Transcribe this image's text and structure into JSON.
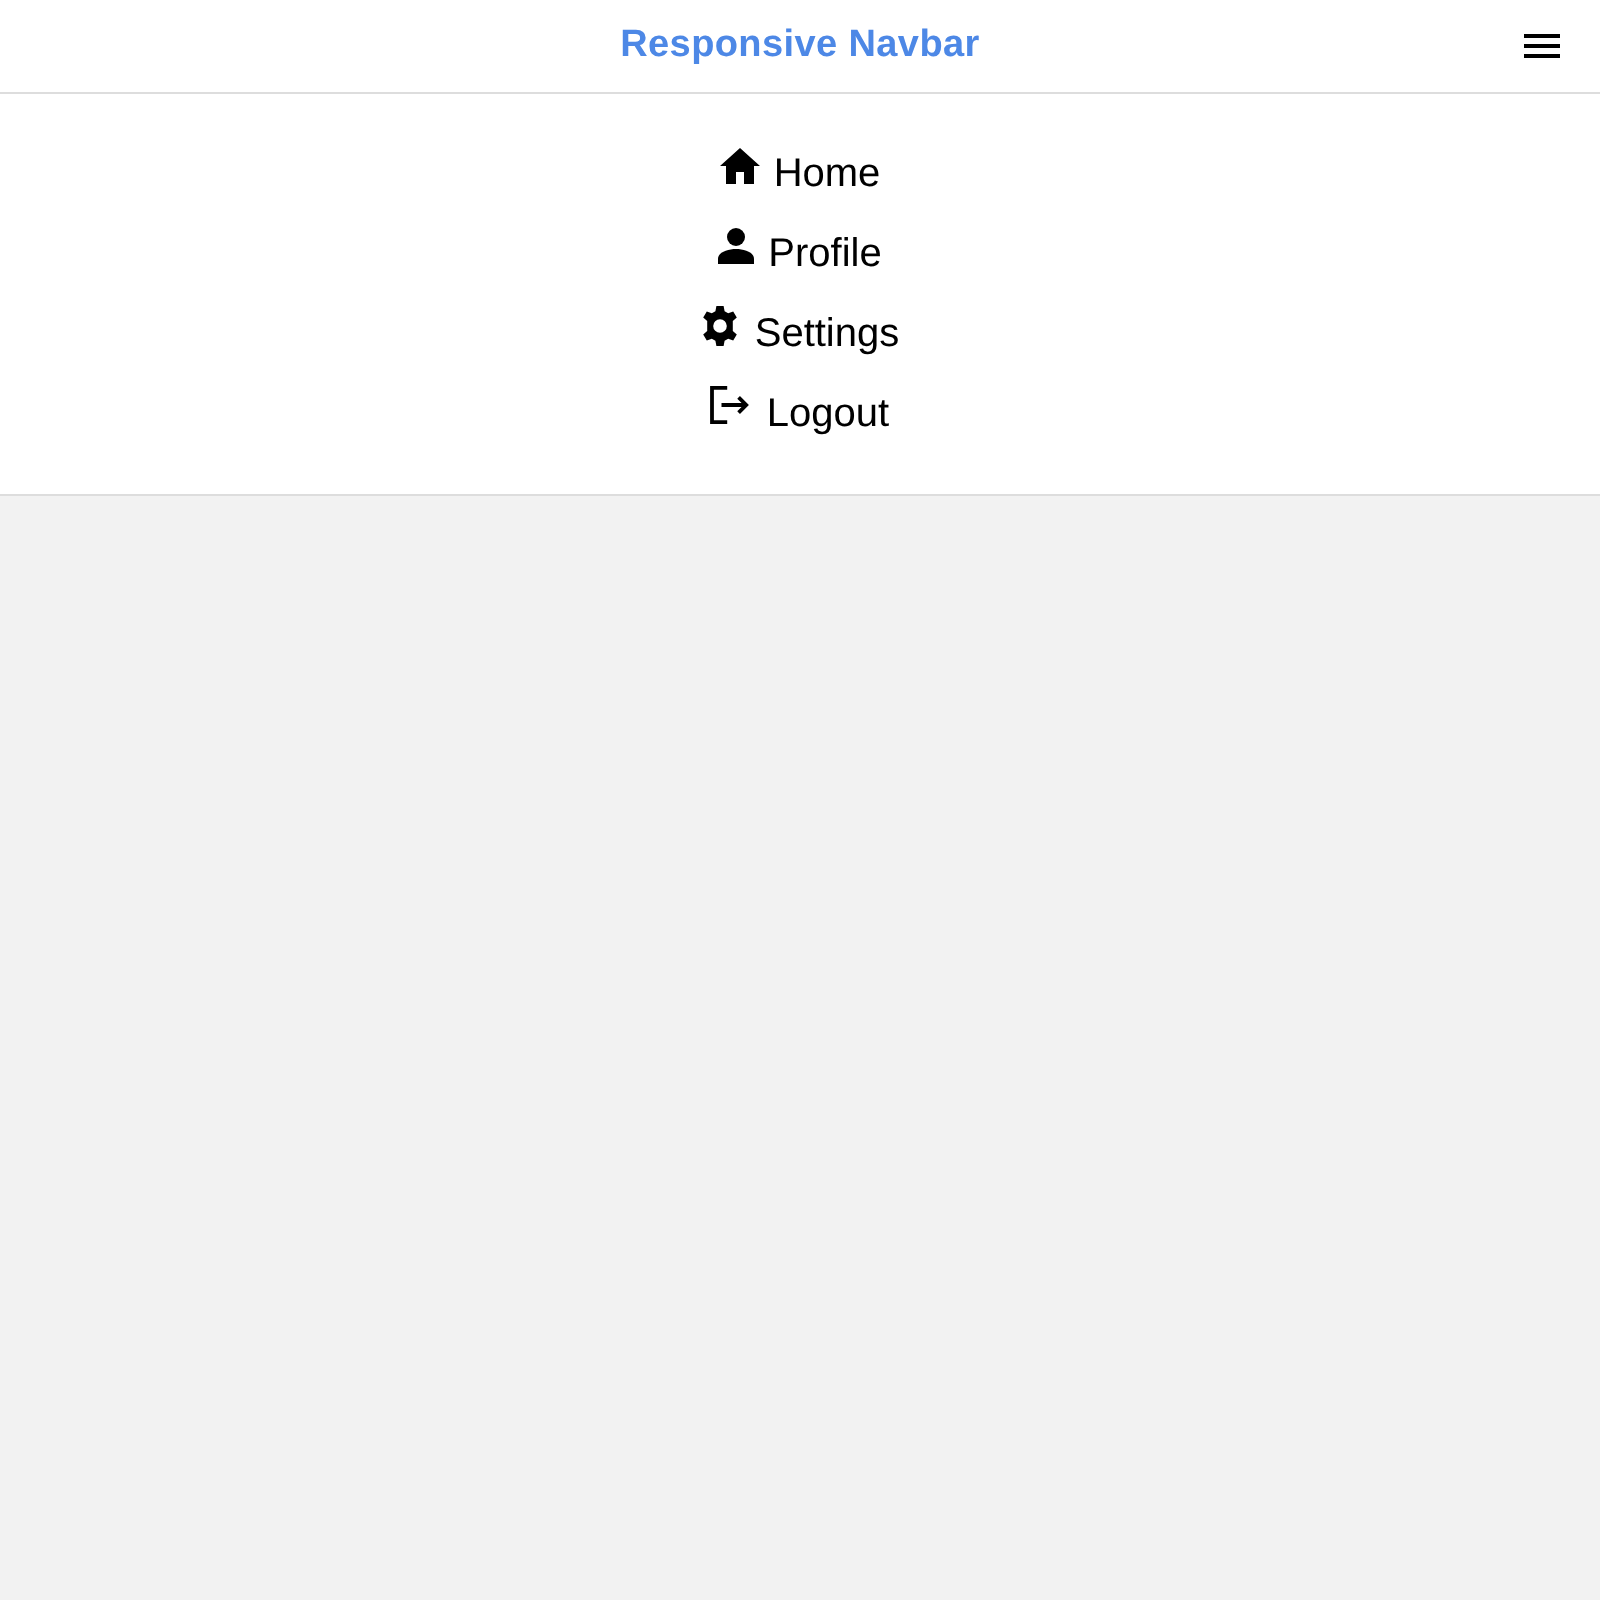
{
  "navbar": {
    "title": "Responsive Navbar"
  },
  "menu": {
    "expanded": true,
    "items": [
      {
        "label": "Home"
      },
      {
        "label": "Profile"
      },
      {
        "label": "Settings"
      },
      {
        "label": "Logout"
      }
    ]
  }
}
